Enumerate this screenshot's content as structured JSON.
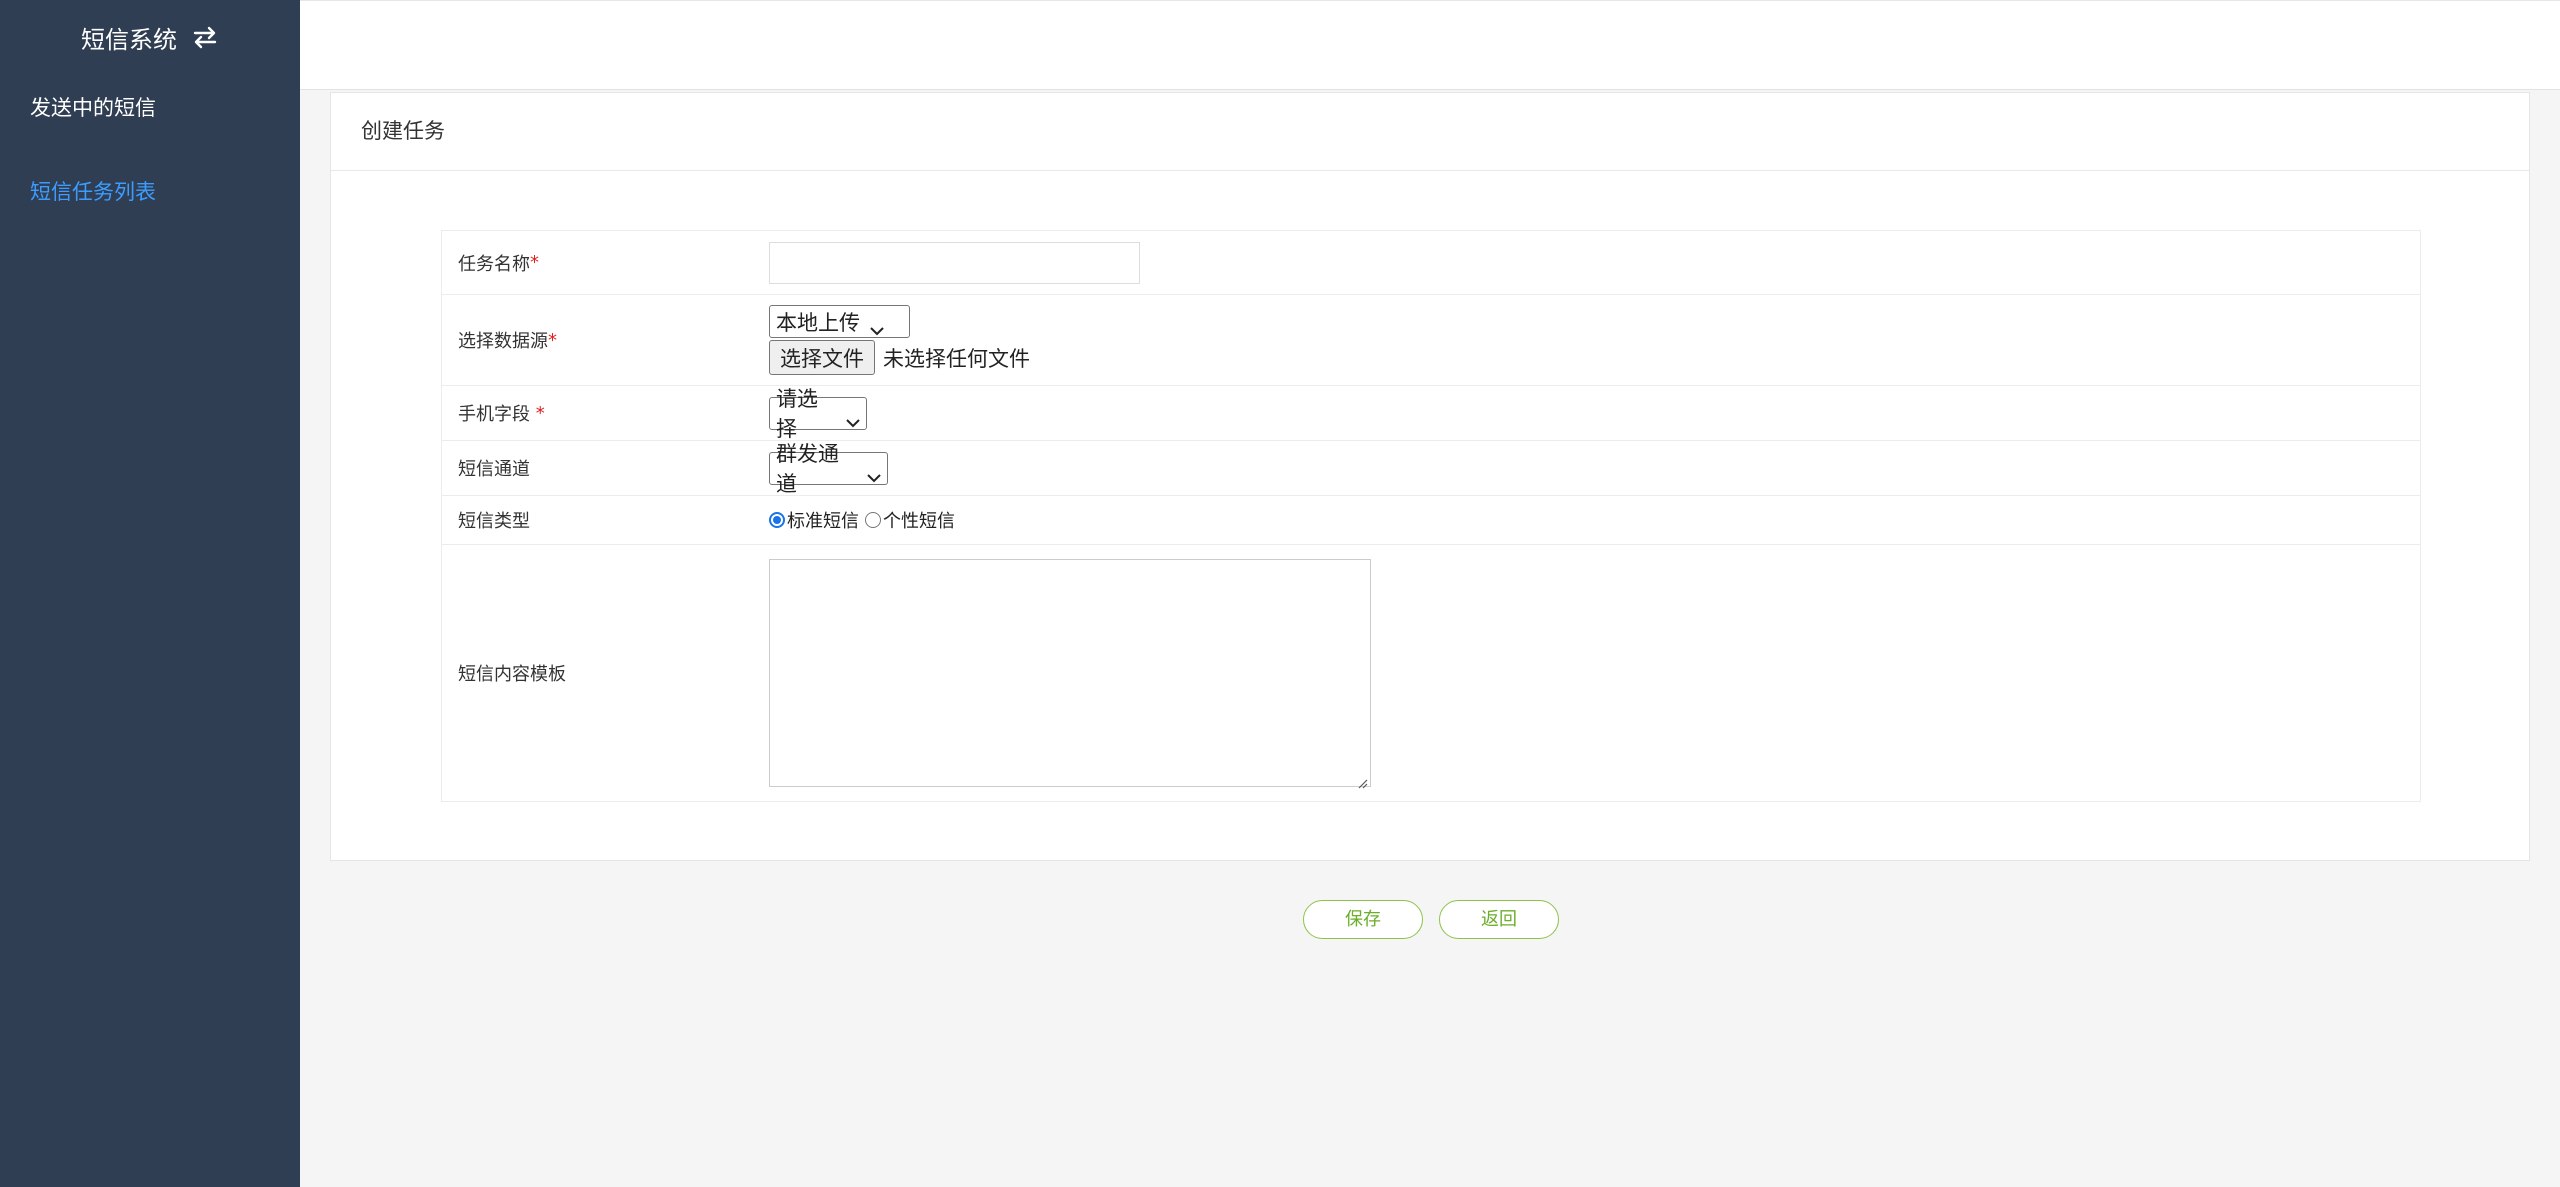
{
  "sidebar": {
    "title": "短信系统",
    "toggle_icon": "swap-icon",
    "items": [
      {
        "label": "发送中的短信",
        "active": false
      },
      {
        "label": "短信任务列表",
        "active": true
      }
    ]
  },
  "panel": {
    "title": "创建任务"
  },
  "form": {
    "task_name": {
      "label": "任务名称",
      "required": "*",
      "value": ""
    },
    "data_source": {
      "label": "选择数据源",
      "required": "*",
      "selected": "本地上传",
      "file_button": "选择文件",
      "file_status": "未选择任何文件"
    },
    "phone_field": {
      "label": "手机字段 ",
      "required": "*",
      "selected": "请选择"
    },
    "sms_channel": {
      "label": "短信通道",
      "selected": "群发通道"
    },
    "sms_type": {
      "label": "短信类型",
      "options": [
        "标准短信",
        "个性短信"
      ],
      "checked_index": 0
    },
    "template": {
      "label": "短信内容模板",
      "value": ""
    }
  },
  "actions": {
    "save_label": "保存",
    "back_label": "返回"
  },
  "colors": {
    "sidebar_bg": "#2f3e52",
    "active_nav": "#3d9cff",
    "required": "#e02020",
    "button_accent": "#8bc34a"
  }
}
